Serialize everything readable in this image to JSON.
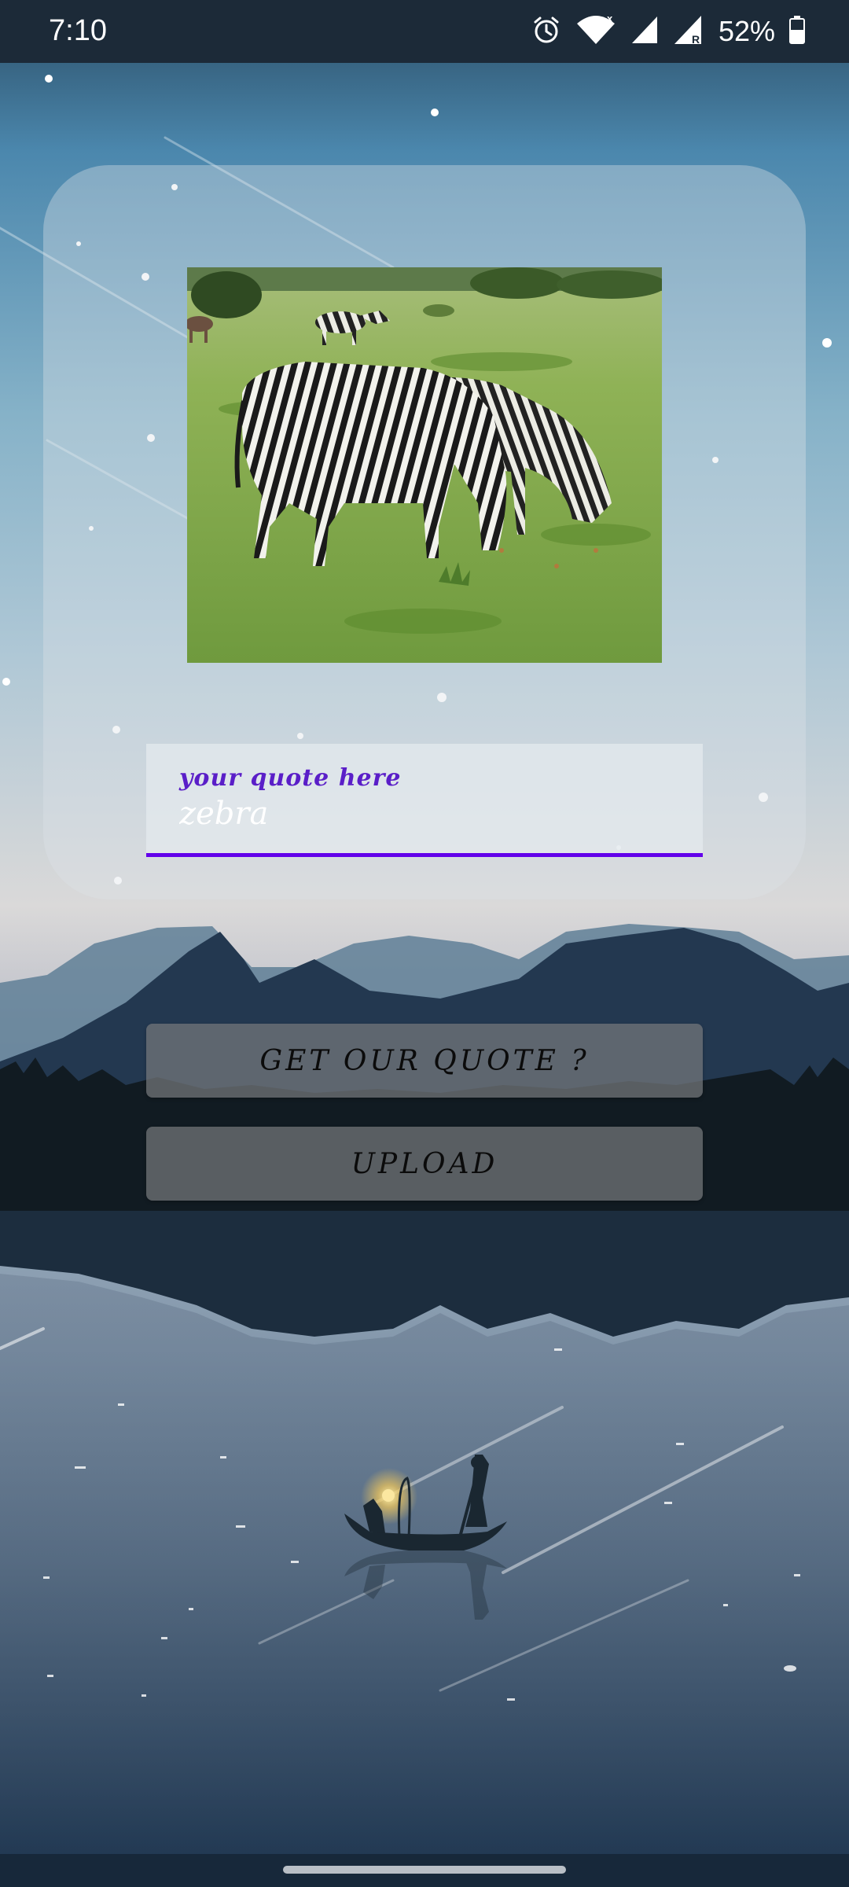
{
  "status_bar": {
    "time": "7:10",
    "battery_text": "52%",
    "icons": [
      "alarm-icon",
      "wifi-icon",
      "signal-x-icon",
      "signal-r-icon",
      "battery-icon"
    ]
  },
  "card": {
    "image_icon": "zebra-photo",
    "quote_field": {
      "label": "your quote here",
      "value": "zebra",
      "accent_color": "#6200ea"
    }
  },
  "actions": {
    "get_quote_label": "GET OUR QUOTE ?",
    "upload_label": "UPLOAD"
  },
  "colors": {
    "accent": "#6200ea",
    "label": "#5a1ec8",
    "button_bg": "#76787c"
  }
}
